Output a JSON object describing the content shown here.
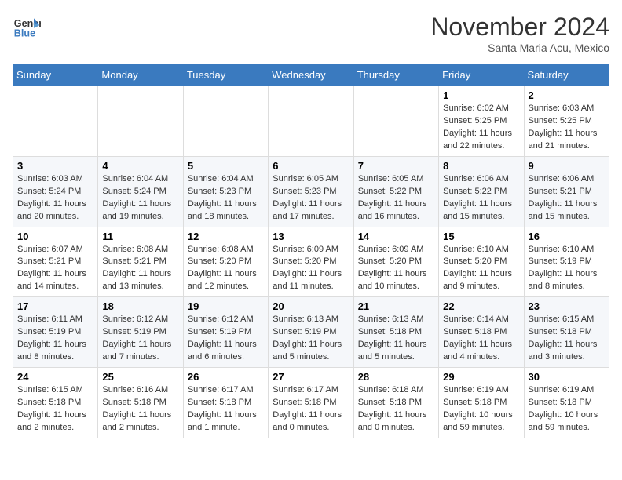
{
  "header": {
    "logo_line1": "General",
    "logo_line2": "Blue",
    "month": "November 2024",
    "location": "Santa Maria Acu, Mexico"
  },
  "weekdays": [
    "Sunday",
    "Monday",
    "Tuesday",
    "Wednesday",
    "Thursday",
    "Friday",
    "Saturday"
  ],
  "weeks": [
    [
      {
        "day": "",
        "text": ""
      },
      {
        "day": "",
        "text": ""
      },
      {
        "day": "",
        "text": ""
      },
      {
        "day": "",
        "text": ""
      },
      {
        "day": "",
        "text": ""
      },
      {
        "day": "1",
        "text": "Sunrise: 6:02 AM\nSunset: 5:25 PM\nDaylight: 11 hours and 22 minutes."
      },
      {
        "day": "2",
        "text": "Sunrise: 6:03 AM\nSunset: 5:25 PM\nDaylight: 11 hours and 21 minutes."
      }
    ],
    [
      {
        "day": "3",
        "text": "Sunrise: 6:03 AM\nSunset: 5:24 PM\nDaylight: 11 hours and 20 minutes."
      },
      {
        "day": "4",
        "text": "Sunrise: 6:04 AM\nSunset: 5:24 PM\nDaylight: 11 hours and 19 minutes."
      },
      {
        "day": "5",
        "text": "Sunrise: 6:04 AM\nSunset: 5:23 PM\nDaylight: 11 hours and 18 minutes."
      },
      {
        "day": "6",
        "text": "Sunrise: 6:05 AM\nSunset: 5:23 PM\nDaylight: 11 hours and 17 minutes."
      },
      {
        "day": "7",
        "text": "Sunrise: 6:05 AM\nSunset: 5:22 PM\nDaylight: 11 hours and 16 minutes."
      },
      {
        "day": "8",
        "text": "Sunrise: 6:06 AM\nSunset: 5:22 PM\nDaylight: 11 hours and 15 minutes."
      },
      {
        "day": "9",
        "text": "Sunrise: 6:06 AM\nSunset: 5:21 PM\nDaylight: 11 hours and 15 minutes."
      }
    ],
    [
      {
        "day": "10",
        "text": "Sunrise: 6:07 AM\nSunset: 5:21 PM\nDaylight: 11 hours and 14 minutes."
      },
      {
        "day": "11",
        "text": "Sunrise: 6:08 AM\nSunset: 5:21 PM\nDaylight: 11 hours and 13 minutes."
      },
      {
        "day": "12",
        "text": "Sunrise: 6:08 AM\nSunset: 5:20 PM\nDaylight: 11 hours and 12 minutes."
      },
      {
        "day": "13",
        "text": "Sunrise: 6:09 AM\nSunset: 5:20 PM\nDaylight: 11 hours and 11 minutes."
      },
      {
        "day": "14",
        "text": "Sunrise: 6:09 AM\nSunset: 5:20 PM\nDaylight: 11 hours and 10 minutes."
      },
      {
        "day": "15",
        "text": "Sunrise: 6:10 AM\nSunset: 5:20 PM\nDaylight: 11 hours and 9 minutes."
      },
      {
        "day": "16",
        "text": "Sunrise: 6:10 AM\nSunset: 5:19 PM\nDaylight: 11 hours and 8 minutes."
      }
    ],
    [
      {
        "day": "17",
        "text": "Sunrise: 6:11 AM\nSunset: 5:19 PM\nDaylight: 11 hours and 8 minutes."
      },
      {
        "day": "18",
        "text": "Sunrise: 6:12 AM\nSunset: 5:19 PM\nDaylight: 11 hours and 7 minutes."
      },
      {
        "day": "19",
        "text": "Sunrise: 6:12 AM\nSunset: 5:19 PM\nDaylight: 11 hours and 6 minutes."
      },
      {
        "day": "20",
        "text": "Sunrise: 6:13 AM\nSunset: 5:19 PM\nDaylight: 11 hours and 5 minutes."
      },
      {
        "day": "21",
        "text": "Sunrise: 6:13 AM\nSunset: 5:18 PM\nDaylight: 11 hours and 5 minutes."
      },
      {
        "day": "22",
        "text": "Sunrise: 6:14 AM\nSunset: 5:18 PM\nDaylight: 11 hours and 4 minutes."
      },
      {
        "day": "23",
        "text": "Sunrise: 6:15 AM\nSunset: 5:18 PM\nDaylight: 11 hours and 3 minutes."
      }
    ],
    [
      {
        "day": "24",
        "text": "Sunrise: 6:15 AM\nSunset: 5:18 PM\nDaylight: 11 hours and 2 minutes."
      },
      {
        "day": "25",
        "text": "Sunrise: 6:16 AM\nSunset: 5:18 PM\nDaylight: 11 hours and 2 minutes."
      },
      {
        "day": "26",
        "text": "Sunrise: 6:17 AM\nSunset: 5:18 PM\nDaylight: 11 hours and 1 minute."
      },
      {
        "day": "27",
        "text": "Sunrise: 6:17 AM\nSunset: 5:18 PM\nDaylight: 11 hours and 0 minutes."
      },
      {
        "day": "28",
        "text": "Sunrise: 6:18 AM\nSunset: 5:18 PM\nDaylight: 11 hours and 0 minutes."
      },
      {
        "day": "29",
        "text": "Sunrise: 6:19 AM\nSunset: 5:18 PM\nDaylight: 10 hours and 59 minutes."
      },
      {
        "day": "30",
        "text": "Sunrise: 6:19 AM\nSunset: 5:18 PM\nDaylight: 10 hours and 59 minutes."
      }
    ]
  ]
}
